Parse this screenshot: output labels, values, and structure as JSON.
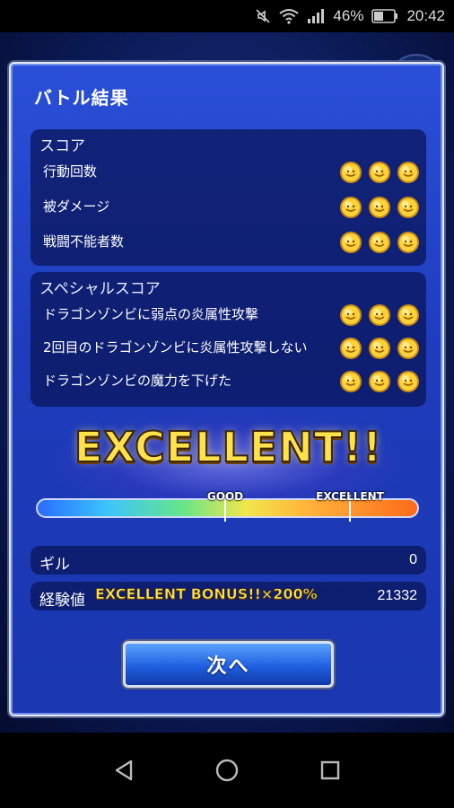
{
  "status_bar": {
    "battery": "46%",
    "time": "20:42"
  },
  "dialog": {
    "title": "バトル結果",
    "score": {
      "heading": "スコア",
      "rows": [
        {
          "label": "行動回数",
          "medals": 3
        },
        {
          "label": "被ダメージ",
          "medals": 3
        },
        {
          "label": "戦闘不能者数",
          "medals": 3
        }
      ]
    },
    "special_score": {
      "heading": "スペシャルスコア",
      "rows": [
        {
          "label": "ドラゴンゾンビに弱点の炎属性攻撃",
          "medals": 3
        },
        {
          "label": "2回目のドラゴンゾンビに炎属性攻撃しない",
          "medals": 3
        },
        {
          "label": "ドラゴンゾンビの魔力を下げた",
          "medals": 3
        }
      ]
    },
    "rank": "EXCELLENT!!",
    "gauge": {
      "good_label": "GOOD",
      "excellent_label": "EXCELLENT"
    },
    "gil": {
      "label": "ギル",
      "value": "0"
    },
    "exp": {
      "label": "経験値",
      "bonus": "EXCELLENT BONUS!!×200%",
      "value": "21332"
    },
    "next_button": "次へ"
  },
  "colors": {
    "dialog_bg": "#1e3cbc",
    "panel_bg": "#0a165a",
    "rank_text": "#ffe24a"
  }
}
